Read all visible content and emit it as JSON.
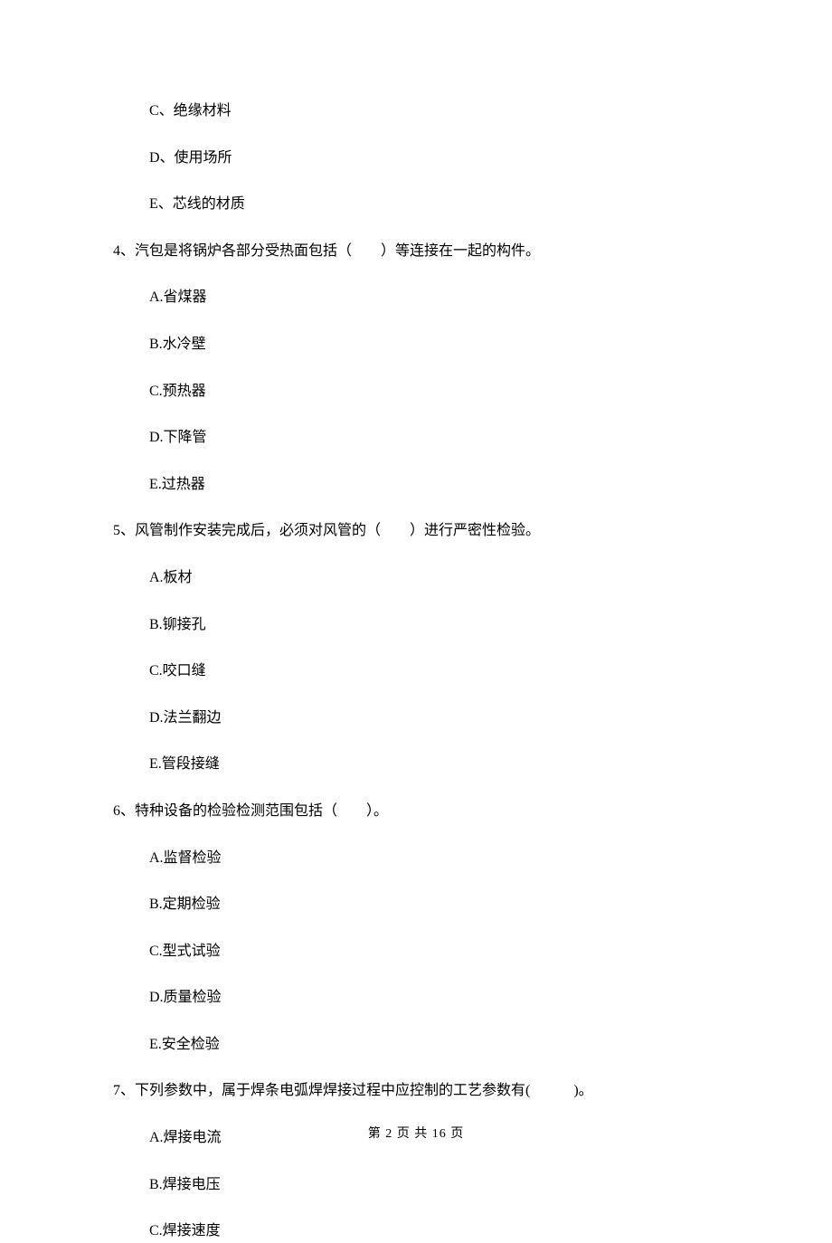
{
  "q3_tail_options": [
    "C、绝缘材料",
    "D、使用场所",
    "E、芯线的材质"
  ],
  "q4": {
    "stem": "4、汽包是将锅炉各部分受热面包括（　　）等连接在一起的构件。",
    "options": [
      "A.省煤器",
      "B.水冷壁",
      "C.预热器",
      "D.下降管",
      "E.过热器"
    ]
  },
  "q5": {
    "stem": "5、风管制作安装完成后，必须对风管的（　　）进行严密性检验。",
    "options": [
      "A.板材",
      "B.铆接孔",
      "C.咬口缝",
      "D.法兰翻边",
      "E.管段接缝"
    ]
  },
  "q6": {
    "stem": "6、特种设备的检验检测范围包括（　　）。",
    "options": [
      "A.监督检验",
      "B.定期检验",
      "C.型式试验",
      "D.质量检验",
      "E.安全检验"
    ]
  },
  "q7": {
    "stem": "7、下列参数中，属于焊条电弧焊焊接过程中应控制的工艺参数有(　　　)。",
    "options": [
      "A.焊接电流",
      "B.焊接电压",
      "C.焊接速度"
    ]
  },
  "footer": "第 2 页 共 16 页"
}
